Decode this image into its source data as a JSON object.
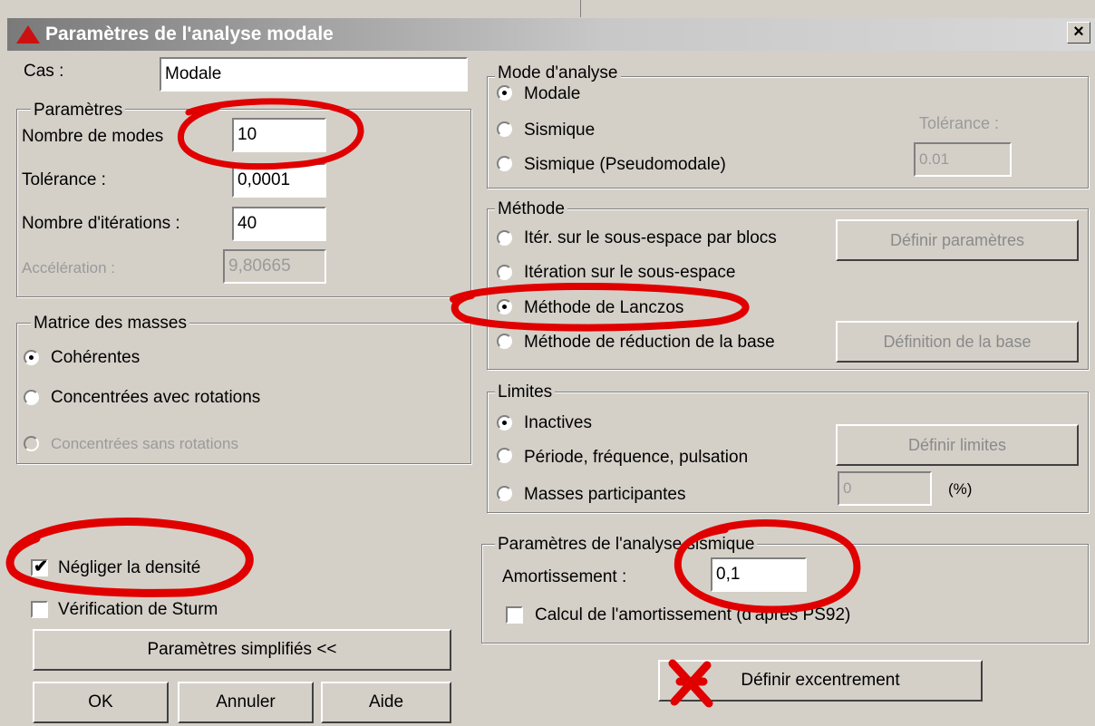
{
  "dialog": {
    "title": "Paramètres de l'analyse modale",
    "close_label": "×"
  },
  "case": {
    "label": "Cas :",
    "value": "Modale"
  },
  "parametres": {
    "legend": "Paramètres",
    "nb_modes_label": "Nombre de modes",
    "nb_modes_value": "10",
    "tolerance_label": "Tolérance :",
    "tolerance_value": "0,0001",
    "iterations_label": "Nombre d'itérations :",
    "iterations_value": "40",
    "acceleration_label": "Accélération :",
    "acceleration_value": "9,80665"
  },
  "mass_matrix": {
    "legend": "Matrice des masses",
    "options": [
      "Cohérentes",
      "Concentrées avec rotations",
      "Concentrées sans rotations"
    ],
    "selected_index": 0
  },
  "density": {
    "label": "Négliger la densité",
    "checked": true
  },
  "sturm": {
    "label": "Vérification de Sturm",
    "checked": false
  },
  "buttons": {
    "simplified": "Paramètres simplifiés <<",
    "ok": "OK",
    "cancel": "Annuler",
    "help": "Aide",
    "eccentricity": "Définir excentrement"
  },
  "analysis_mode": {
    "legend": "Mode d'analyse",
    "options": [
      "Modale",
      "Sismique",
      "Sismique (Pseudomodale)"
    ],
    "selected_index": 0,
    "tolerance_label": "Tolérance :",
    "tolerance_value": "0.01"
  },
  "method": {
    "legend": "Méthode",
    "options": [
      "Itér. sur le sous-espace par blocs",
      "Itération sur le sous-espace",
      "Méthode de Lanczos",
      "Méthode de réduction de la base"
    ],
    "selected_index": 2,
    "define_params": "Définir paramètres",
    "define_base": "Définition de la base"
  },
  "limits": {
    "legend": "Limites",
    "options": [
      "Inactives",
      "Période, fréquence, pulsation",
      "Masses participantes"
    ],
    "selected_index": 0,
    "define_limits": "Définir limites",
    "value": "0",
    "unit": "(%)"
  },
  "seismic": {
    "legend": "Paramètres de l'analyse sismique",
    "damping_label": "Amortissement :",
    "damping_value": "0,1",
    "calc_damping_label": "Calcul de l'amortissement (d'après PS92)",
    "calc_checked": false
  },
  "colors": {
    "annotation": "#e00000",
    "dialog_bg": "#d4d0c8"
  }
}
